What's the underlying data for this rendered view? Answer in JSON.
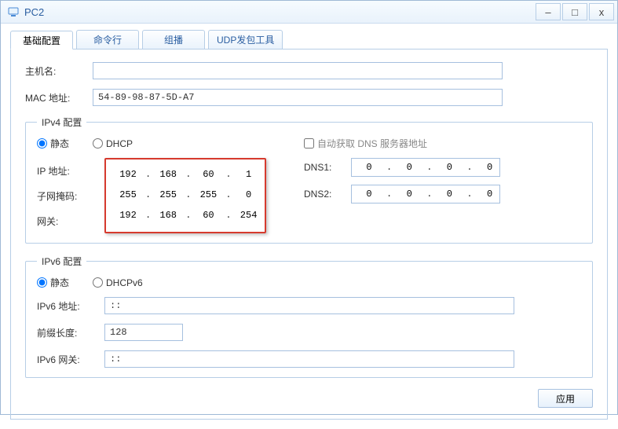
{
  "window": {
    "title": "PC2"
  },
  "tabs": {
    "basic": "基础配置",
    "cmd": "命令行",
    "mcast": "组播",
    "udp": "UDP发包工具"
  },
  "labels": {
    "hostname": "主机名:",
    "mac": "MAC 地址:",
    "ipv4": "IPv4 配置",
    "static": "静态",
    "dhcp": "DHCP",
    "auto_dns": "自动获取 DNS 服务器地址",
    "ip": "IP 地址:",
    "mask": "子网掩码:",
    "gw": "网关:",
    "dns1": "DNS1:",
    "dns2": "DNS2:",
    "ipv6": "IPv6 配置",
    "static6": "静态",
    "dhcp6": "DHCPv6",
    "ipv6addr": "IPv6 地址:",
    "prefix": "前缀长度:",
    "ipv6gw": "IPv6 网关:",
    "apply": "应用"
  },
  "values": {
    "hostname": "",
    "mac": "54-89-98-87-5D-A7",
    "ipv4_mode": "static",
    "auto_dns": false,
    "ip": {
      "a": "192",
      "b": "168",
      "c": "60",
      "d": "1"
    },
    "mask": {
      "a": "255",
      "b": "255",
      "c": "255",
      "d": "0"
    },
    "gw": {
      "a": "192",
      "b": "168",
      "c": "60",
      "d": "254"
    },
    "dns1": {
      "a": "0",
      "b": "0",
      "c": "0",
      "d": "0"
    },
    "dns2": {
      "a": "0",
      "b": "0",
      "c": "0",
      "d": "0"
    },
    "ipv6_mode": "static",
    "ipv6addr": "::",
    "prefix": "128",
    "ipv6gw": "::"
  }
}
